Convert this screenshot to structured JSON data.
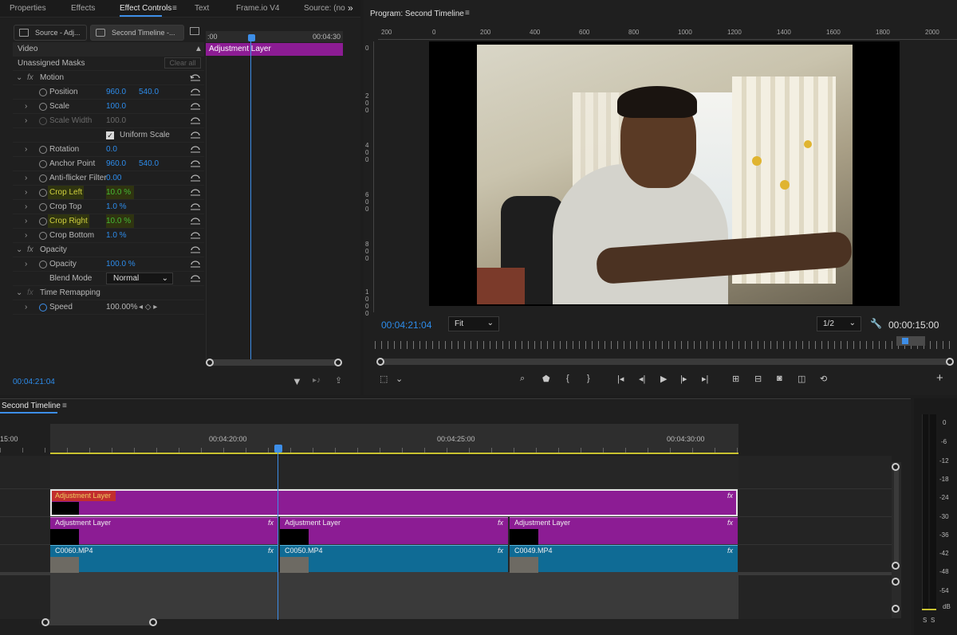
{
  "top_tabs": [
    "Properties",
    "Effects",
    "Effect Controls",
    "Text",
    "Frame.io V4",
    "Source: (no"
  ],
  "effect_controls": {
    "source_tab": "Source - Adj...",
    "sequence_tab": "Second Timeline -...",
    "mini_timecode_start": ":00",
    "mini_timecode_end": "00:04:30",
    "mini_clip_label": "Adjustment Layer",
    "video_header": "Video",
    "unassigned_masks": "Unassigned Masks",
    "clear_all": "Clear all",
    "motion": "Motion",
    "position_label": "Position",
    "position_x": "960.0",
    "position_y": "540.0",
    "scale_label": "Scale",
    "scale_val": "100.0",
    "scale_width_label": "Scale Width",
    "scale_width_val": "100.0",
    "uniform_scale": "Uniform Scale",
    "rotation_label": "Rotation",
    "rotation_val": "0.0",
    "anchor_label": "Anchor Point",
    "anchor_x": "960.0",
    "anchor_y": "540.0",
    "antiflicker_label": "Anti-flicker Filter",
    "antiflicker_val": "0.00",
    "crop_left_label": "Crop Left",
    "crop_left_val": "10.0 %",
    "crop_top_label": "Crop Top",
    "crop_top_val": "1.0 %",
    "crop_right_label": "Crop Right",
    "crop_right_val": "10.0 %",
    "crop_bottom_label": "Crop Bottom",
    "crop_bottom_val": "1.0 %",
    "opacity_group": "Opacity",
    "opacity_label": "Opacity",
    "opacity_val": "100.0 %",
    "blend_label": "Blend Mode",
    "blend_val": "Normal",
    "time_remap": "Time Remapping",
    "speed_label": "Speed",
    "speed_val": "100.00%",
    "timecode": "00:04:21:04"
  },
  "program_monitor": {
    "title": "Program: Second Timeline",
    "ruler_labels": [
      "200",
      "0",
      "200",
      "400",
      "600",
      "800",
      "1000",
      "1200",
      "1400",
      "1600",
      "1800",
      "2000"
    ],
    "vruler_labels": [
      "0",
      "200",
      "400",
      "600",
      "800",
      "1000"
    ],
    "timecode": "00:04:21:04",
    "fit": "Fit",
    "resolution": "1/2",
    "duration": "00:00:15:00"
  },
  "timeline": {
    "title": "Second Timeline",
    "time_left": "15:00",
    "time_marks": [
      "00:04:20:00",
      "00:04:25:00",
      "00:04:30:00"
    ],
    "v3_clip": "Adjustment Layer",
    "v2_clips": [
      "Adjustment Layer",
      "Adjustment Layer",
      "Adjustment Layer"
    ],
    "v1_clips": [
      "C0060.MP4",
      "C0050.MP4",
      "C0049.MP4"
    ],
    "fx_badge": "fx"
  },
  "audio_meter": {
    "scale": [
      "0",
      "-6",
      "-12",
      "-18",
      "-24",
      "-30",
      "-36",
      "-42",
      "-48",
      "-54",
      "dB"
    ],
    "channels": [
      "S",
      "S"
    ]
  }
}
